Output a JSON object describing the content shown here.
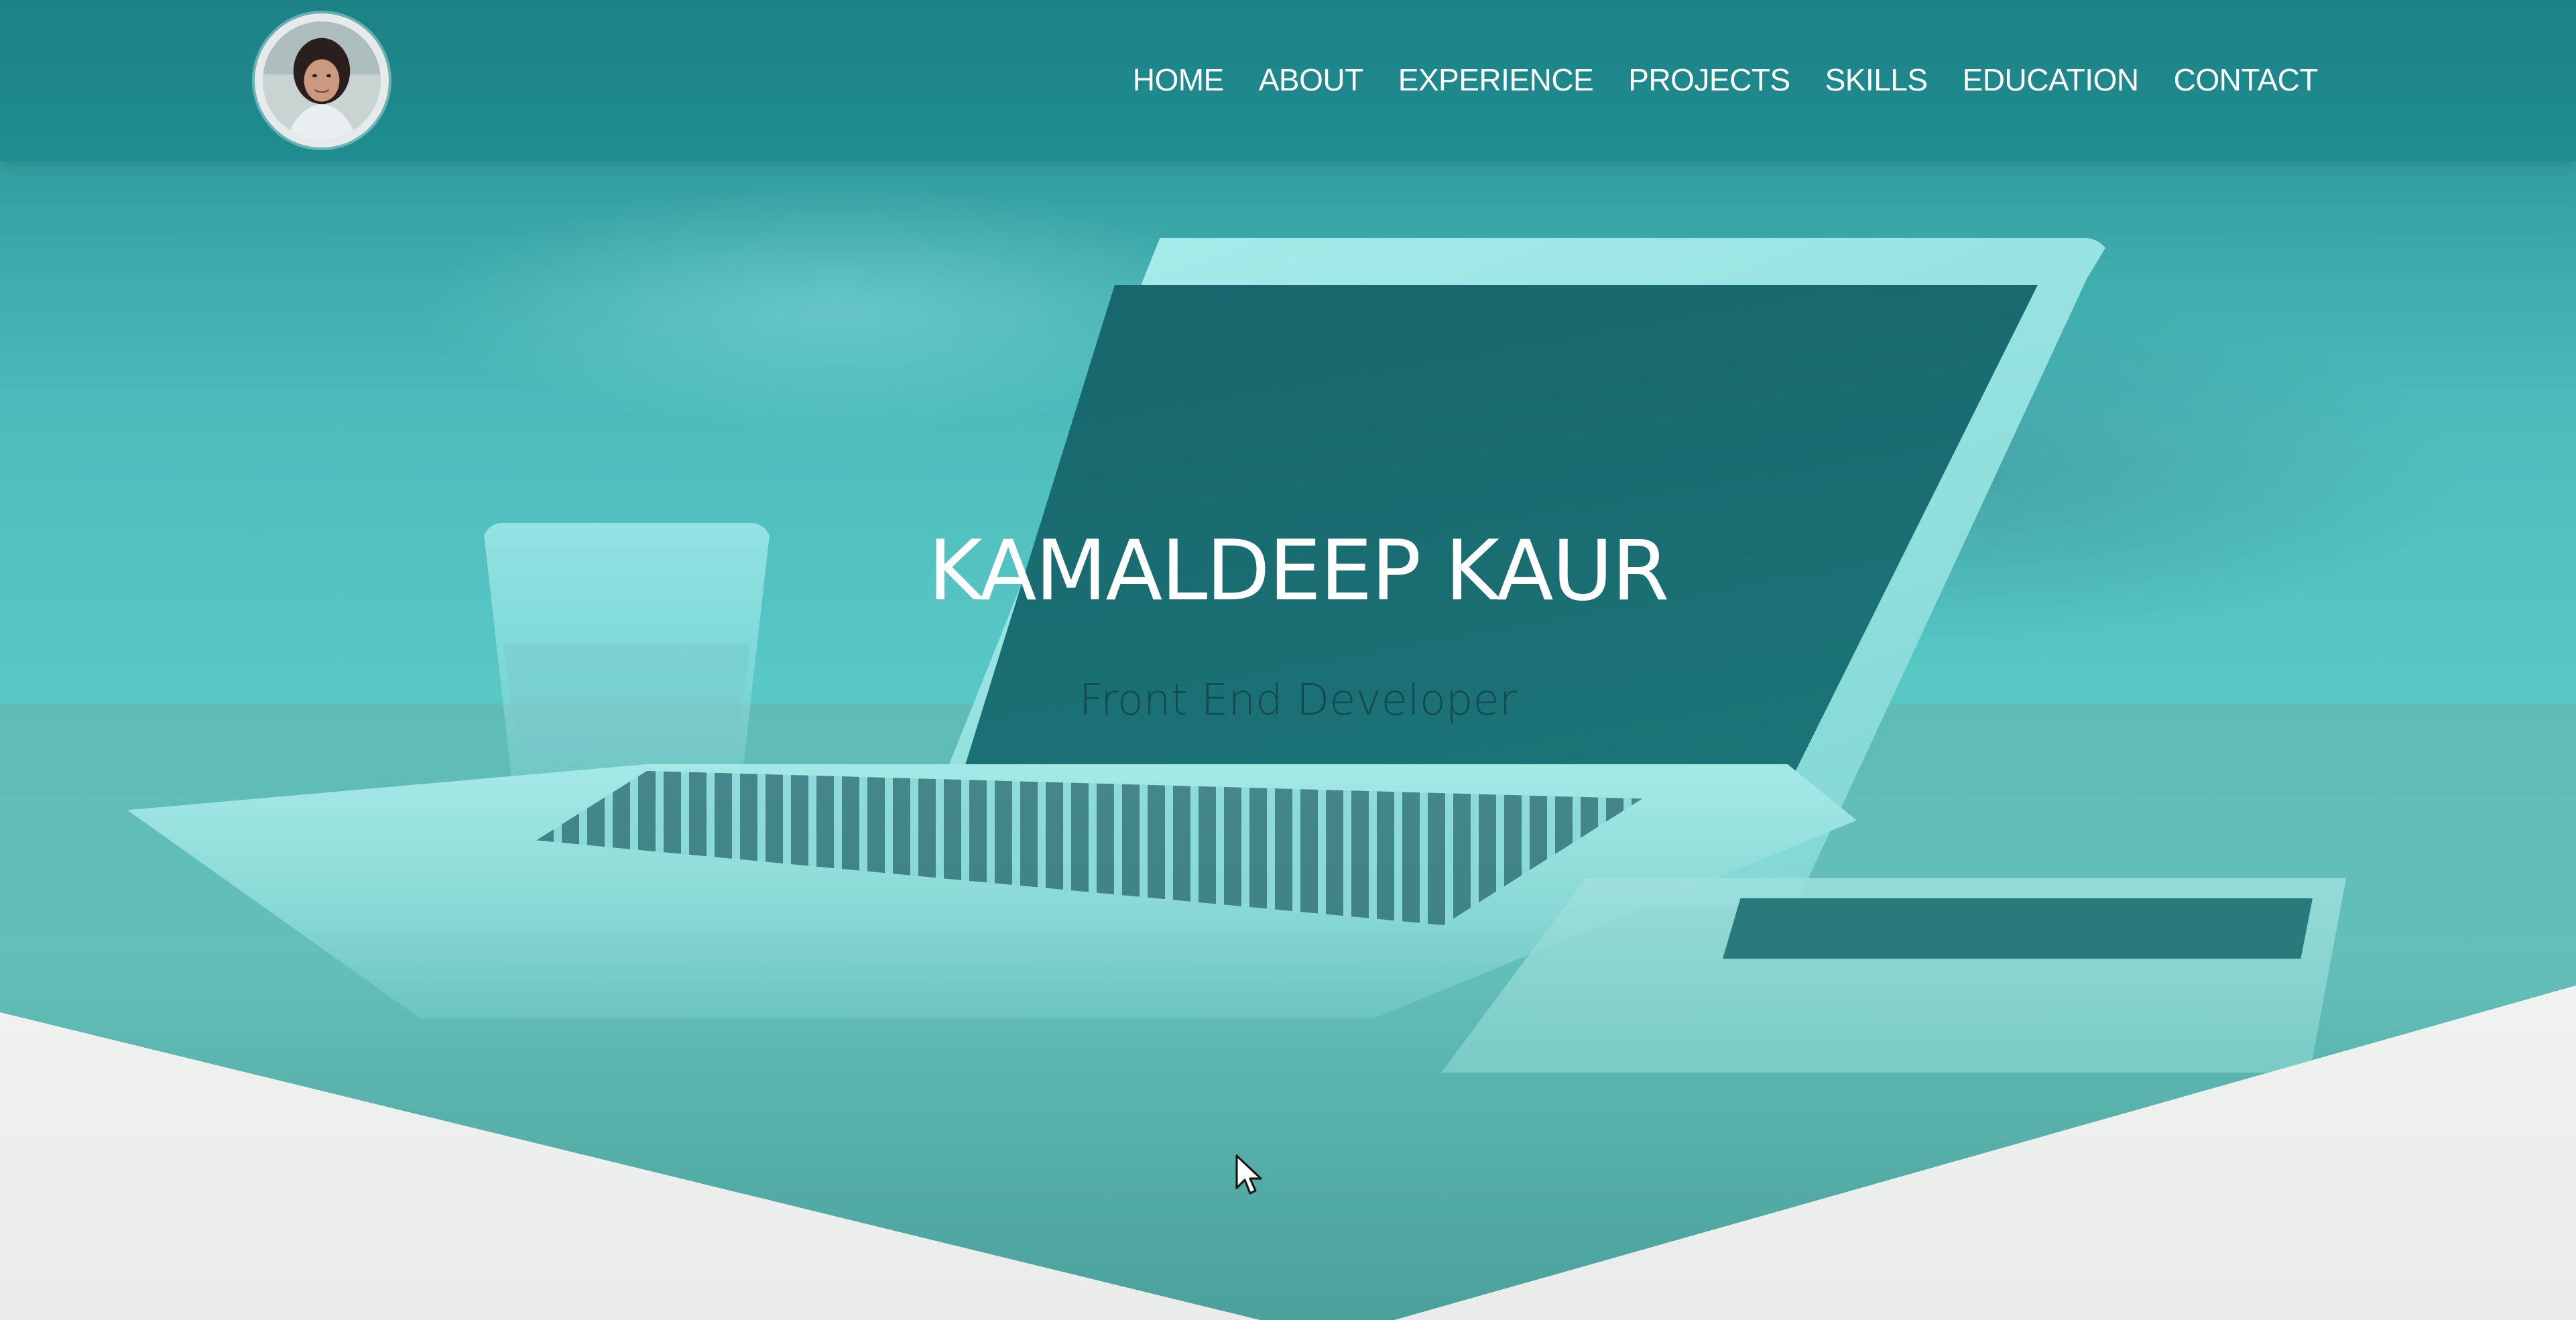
{
  "site": {
    "avatar_alt": "Profile photo"
  },
  "nav": {
    "items": [
      {
        "label": "HOME"
      },
      {
        "label": "ABOUT"
      },
      {
        "label": "EXPERIENCE"
      },
      {
        "label": "PROJECTS"
      },
      {
        "label": "SKILLS"
      },
      {
        "label": "EDUCATION"
      },
      {
        "label": "CONTACT"
      }
    ]
  },
  "hero": {
    "name": "KAMALDEEP KAUR",
    "role": "Front End Developer"
  },
  "colors": {
    "navbar": "#1c8286",
    "hero_teal": "#58c9c6",
    "name_text": "#ffffff",
    "role_text": "#134a4e",
    "lower_bg": "#eef0ee"
  },
  "icons": {
    "cursor": "mouse-pointer-icon"
  }
}
